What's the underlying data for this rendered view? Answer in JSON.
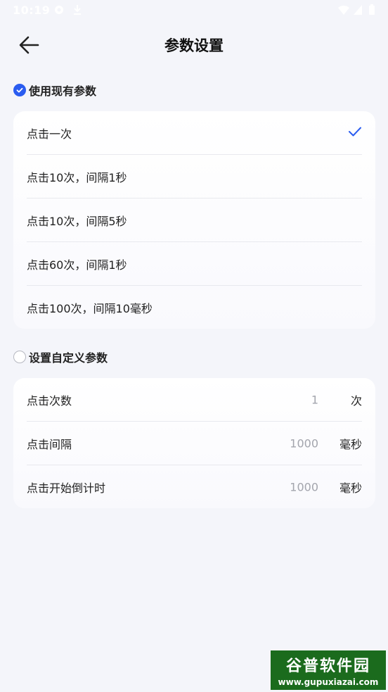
{
  "status_bar": {
    "time": "10:19"
  },
  "header": {
    "title": "参数设置"
  },
  "preset_section": {
    "label": "使用现有参数",
    "selected": true,
    "options": [
      {
        "label": "点击一次",
        "checked": true
      },
      {
        "label": "点击10次，间隔1秒",
        "checked": false
      },
      {
        "label": "点击10次，间隔5秒",
        "checked": false
      },
      {
        "label": "点击60次，间隔1秒",
        "checked": false
      },
      {
        "label": "点击100次，间隔10毫秒",
        "checked": false
      }
    ]
  },
  "custom_section": {
    "label": "设置自定义参数",
    "selected": false,
    "fields": [
      {
        "label": "点击次数",
        "value": "1",
        "unit": "次"
      },
      {
        "label": "点击间隔",
        "value": "1000",
        "unit": "毫秒"
      },
      {
        "label": "点击开始倒计时",
        "value": "1000",
        "unit": "毫秒"
      }
    ]
  },
  "watermark": {
    "brand": "谷普软件园",
    "url": "www.gupuxiazai.com"
  },
  "colors": {
    "accent": "#2a5cf0",
    "background": "#f4f5fa",
    "card": "#ffffff",
    "divider": "#e8e9ee",
    "muted": "#a3a5ad"
  }
}
